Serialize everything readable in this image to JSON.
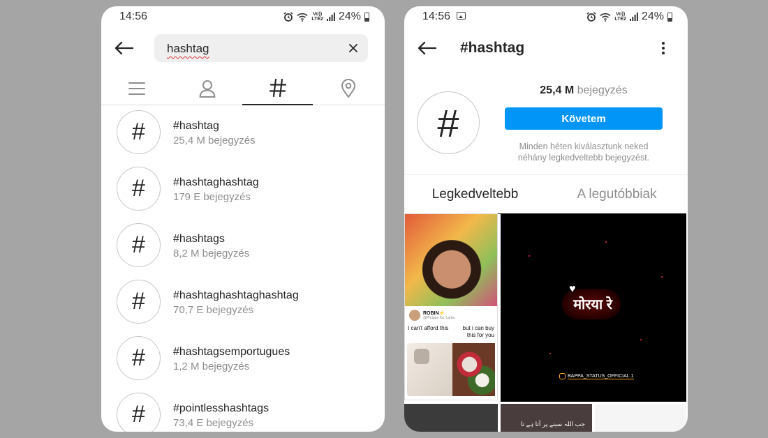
{
  "left_phone": {
    "status": {
      "time": "14:56",
      "battery": "24%",
      "network": "LTE2",
      "volte": "Vo))"
    },
    "search": {
      "query": "hashtag"
    },
    "tabs": [
      {
        "name": "top",
        "icon": "list-icon"
      },
      {
        "name": "accounts",
        "icon": "person-icon"
      },
      {
        "name": "tags",
        "icon": "hashtag-icon",
        "active": true
      },
      {
        "name": "places",
        "icon": "location-pin-icon"
      }
    ],
    "results": [
      {
        "glyph": "#",
        "title": "#hashtag",
        "count": "25,4 M bejegyzés"
      },
      {
        "glyph": "#",
        "title": "#hashtaghashtag",
        "count": "179 E bejegyzés"
      },
      {
        "glyph": "#",
        "title": "#hashtags",
        "count": "8,2 M bejegyzés"
      },
      {
        "glyph": "#",
        "title": "#hashtaghashtaghashtag",
        "count": "70,7 E bejegyzés"
      },
      {
        "glyph": "#",
        "title": "#hashtagsemportugues",
        "count": "1,2 M bejegyzés"
      },
      {
        "glyph": "#",
        "title": "#pointlesshashtags",
        "count": "73,4 E bejegyzés"
      }
    ]
  },
  "right_phone": {
    "status": {
      "time": "14:56",
      "battery": "24%",
      "network": "LTE2",
      "volte": "Vo))"
    },
    "header": {
      "title": "#hashtag"
    },
    "profile": {
      "glyph": "#",
      "post_count": "25,4 M",
      "post_label": "bejegyzés",
      "follow_label": "Követem",
      "hint": "Minden héten kiválasztunk neked néhány legkedveltebb bejegyzést."
    },
    "tabs": {
      "top": "Legkedveltebb",
      "recent": "A legutóbbiak"
    },
    "grid": {
      "collage": {
        "name": "ROBIN⚡",
        "handle": "@Phuppo.Ka_Larka",
        "left_caption": "I can't afford this",
        "right_caption": "but i can buy this for you"
      },
      "video": {
        "text": "मोरया रे",
        "heart": "♥",
        "handle": "BAPPA_STATUS_OFFICIAL.1"
      },
      "bottom_text": "جب اللہ سینے پر آتا ہے تا"
    }
  },
  "colors": {
    "accent": "#0095f6",
    "background": "#a5a5a5",
    "muted": "#8e8e8e"
  }
}
